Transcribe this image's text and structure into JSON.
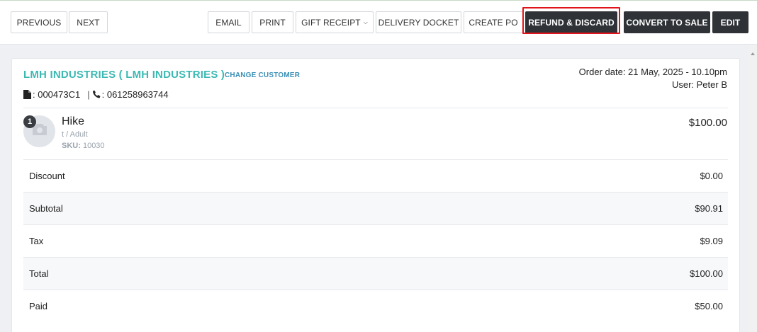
{
  "toolbar": {
    "previous": "PREVIOUS",
    "next": "NEXT",
    "email": "EMAIL",
    "print": "PRINT",
    "gift_receipt": "GIFT RECEIPT",
    "delivery_docket": "DELIVERY DOCKET",
    "create_po": "CREATE PO",
    "refund_discard": "REFUND & DISCARD",
    "convert_to_sale": "CONVERT TO SALE",
    "edit": "EDIT"
  },
  "order": {
    "customer_name": "LMH INDUSTRIES ( LMH INDUSTRIES )",
    "change_customer": "CHANGE CUSTOMER",
    "doc_label": ": 000473C1",
    "phone_label": ": 061258963744",
    "separator": "|",
    "order_date": "Order date: 21 May, 2025 - 10.10pm",
    "user": "User: Peter B"
  },
  "item": {
    "quantity": "1",
    "name": "Hike",
    "variant": "t / Adult",
    "sku_label": "SKU:",
    "sku_value": "10030",
    "price": "$100.00"
  },
  "totals": [
    {
      "label": "Discount",
      "value": "$0.00"
    },
    {
      "label": "Subtotal",
      "value": "$90.91"
    },
    {
      "label": "Tax",
      "value": "$9.09"
    },
    {
      "label": "Total",
      "value": "$100.00"
    },
    {
      "label": "Paid",
      "value": "$50.00"
    }
  ],
  "colors": {
    "accent": "#3cb9b3",
    "link": "#3a8fb5",
    "dark_button": "#2f3237",
    "highlight": "#e0151b"
  },
  "icons": {
    "document": "document-icon",
    "phone": "phone-icon",
    "camera": "camera-icon",
    "dropdown": "chevron-down-icon"
  }
}
